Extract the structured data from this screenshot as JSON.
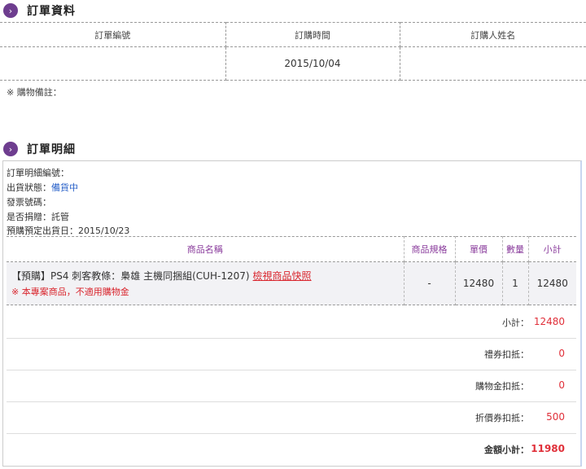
{
  "order_info": {
    "title": "訂單資料",
    "columns": [
      "訂單編號",
      "訂購時間",
      "訂購人姓名"
    ],
    "row": [
      "",
      "2015/10/04",
      ""
    ],
    "memo": "※ 購物備註："
  },
  "order_detail": {
    "title": "訂單明細",
    "meta": {
      "detail_no": "訂單明細編號：",
      "ship_status_label": "出貨狀態：",
      "ship_status_value": "備貨中",
      "invoice_no": "發票號碼：",
      "donate": "是否捐贈：託管",
      "ship_date": "預購預定出貨日：2015/10/23"
    },
    "columns": [
      "商品名稱",
      "商品規格",
      "單價",
      "數量",
      "小計"
    ],
    "items": [
      {
        "name": "【預購】PS4 刺客教條：梟雄 主機同捆組(CUH-1207)",
        "link": "檢視商品快照",
        "note": "※ 本專案商品，不適用購物金",
        "spec": "-",
        "price": "12480",
        "qty": "1",
        "subtotal": "12480"
      }
    ],
    "summary": [
      {
        "label": "小計：",
        "value": "12480"
      },
      {
        "label": "禮券扣抵：",
        "value": "0"
      },
      {
        "label": "購物金扣抵：",
        "value": "0"
      },
      {
        "label": "折價券扣抵：",
        "value": "500"
      },
      {
        "label": "金額小計：",
        "value": "11980"
      }
    ]
  },
  "icons": {
    "section": "chevron-right-icon"
  },
  "colors": {
    "accent": "#6e3d8f",
    "red": "#d9242c",
    "blue": "#2a62c9",
    "header_text": "#8a3c9c"
  }
}
